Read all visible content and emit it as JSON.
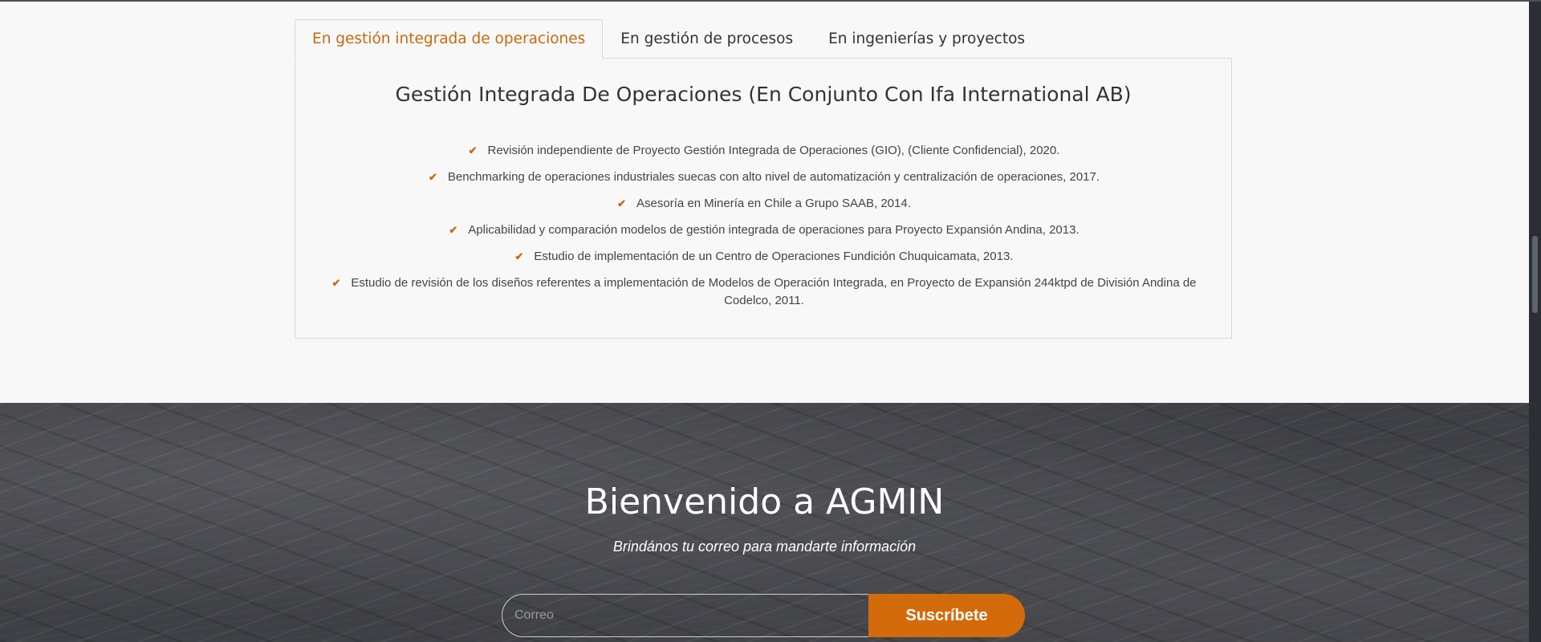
{
  "tabs": [
    {
      "label": "En gestión integrada de operaciones",
      "active": true
    },
    {
      "label": "En gestión de procesos",
      "active": false
    },
    {
      "label": "En ingenierías y proyectos",
      "active": false
    }
  ],
  "panel": {
    "title": "Gestión Integrada De Operaciones (En Conjunto Con Ifa International AB)",
    "items": [
      "Revisión independiente de Proyecto Gestión Integrada de Operaciones (GIO), (Cliente Confidencial), 2020.",
      "Benchmarking de operaciones industriales suecas con alto nivel de automatización y centralización de operaciones, 2017.",
      "Asesoría en Minería en Chile a Grupo SAAB, 2014.",
      "Aplicabilidad y comparación modelos de gestión integrada de operaciones para Proyecto Expansión Andina, 2013.",
      "Estudio de implementación de un Centro de Operaciones Fundición Chuquicamata, 2013.",
      "Estudio de revisión de los diseños referentes a implementación de Modelos de Operación Integrada, en Proyecto de Expansión 244ktpd de División Andina de Codelco, 2011."
    ],
    "item_icon": "check-icon"
  },
  "welcome": {
    "title": "Bienvenido a AGMIN",
    "subtitle": "Brindános tu correo para mandarte información"
  },
  "subscribe": {
    "placeholder": "Correo",
    "button_label": "Suscríbete"
  },
  "colors": {
    "accent": "#c8690d",
    "button": "#d46b0a"
  }
}
